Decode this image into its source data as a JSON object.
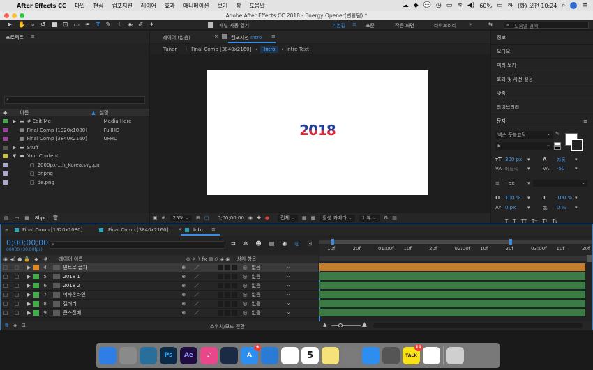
{
  "menubar": {
    "apple": "",
    "app_name": "After Effects CC",
    "items": [
      "파일",
      "편집",
      "컴포지션",
      "레이어",
      "효과",
      "애니메이션",
      "보기",
      "창",
      "도움말"
    ],
    "battery": "60%",
    "input_method": "한",
    "clock": "(화) 오전 10:24"
  },
  "window": {
    "title": "Adobe After Effects CC 2018 - Energy Opener(변환됨) *"
  },
  "toolbar": {
    "auto_open_label": "패널 자동 열기",
    "workspaces": [
      "기본값",
      "표준",
      "작은 화면",
      "라이브러리"
    ],
    "active_workspace": "기본값",
    "help_search_placeholder": "도움말 검색"
  },
  "project_panel": {
    "title": "프로젝트",
    "search_placeholder": "",
    "col_name": "이름",
    "col_desc": "설명",
    "items": [
      {
        "name": "# Edit Me",
        "desc": "Media Here",
        "color": "#3fae49",
        "type": "folder",
        "indent": 0
      },
      {
        "name": "Final Comp [1920x1080]",
        "desc": "FullHD",
        "color": "#a33ea4",
        "type": "comp",
        "indent": 0
      },
      {
        "name": "Final Comp [3840x2160]",
        "desc": "UFHD",
        "color": "#a33ea4",
        "type": "comp",
        "indent": 0
      },
      {
        "name": "Stuff",
        "desc": "",
        "color": "#555555",
        "type": "folder",
        "indent": 0
      },
      {
        "name": "Your Content",
        "desc": "",
        "color": "#c9c534",
        "type": "folder",
        "indent": 0
      },
      {
        "name": "2000px-...h_Korea.svg.png",
        "desc": "",
        "color": "#a7a7cf",
        "type": "file",
        "indent": 1
      },
      {
        "name": "br.png",
        "desc": "",
        "color": "#a7a7cf",
        "type": "file",
        "indent": 1
      },
      {
        "name": "de.png",
        "desc": "",
        "color": "#a7a7cf",
        "type": "file",
        "indent": 1
      }
    ],
    "bpc": "8bpc"
  },
  "viewer": {
    "layer_tab": "레이어 (없음)",
    "comp_tab_prefix": "컴포지션",
    "comp_tab_name": "Intro",
    "breadcrumb": [
      "Tuner",
      "Final Comp [3840x2160]",
      "Intro",
      "Intro Text"
    ],
    "canvas_text": "2018",
    "zoom": "25%",
    "timecode": "0;00;00;00",
    "resolution": "전체",
    "camera": "활성 카메라",
    "views": "1 뷰"
  },
  "right_panel": {
    "items": [
      "정보",
      "오디오",
      "미리 보기",
      "효과 및 사전 설정",
      "맞춤",
      "라이브러리"
    ],
    "character_title": "문자",
    "font_family": "넥슨 풋볼고딕",
    "font_style": "B",
    "font_size": "300 px",
    "leading": "자동",
    "kerning_label": "메트릭",
    "tracking": "-50",
    "stroke_width": "- px",
    "vscale": "100 %",
    "hscale": "100 %",
    "baseline": "0 px",
    "tsume": "0 %"
  },
  "timeline": {
    "tabs": [
      {
        "label": "Final Comp [1920x1080]",
        "color": "#2ba5b5"
      },
      {
        "label": "Final Comp [3840x2160]",
        "color": "#2ba5b5"
      },
      {
        "label": "Intro",
        "color": "#2ba5b5"
      }
    ],
    "timecode": "0;00;00;00",
    "fps": "00000 (30.00fps)",
    "search_placeholder": "",
    "col_num": "#",
    "col_layer": "레이어 이름",
    "col_parent": "상위 항목",
    "ruler_ticks": [
      "10f",
      "20f",
      "01:00f",
      "10f",
      "20f",
      "02:00f",
      "10f",
      "20f",
      "03:00f",
      "10f",
      "20f",
      "2"
    ],
    "layers": [
      {
        "num": "4",
        "name": "인트로 글자",
        "parent": "없음",
        "label_color": "#e08a26",
        "bar_color": "#c27d2f",
        "selected": true
      },
      {
        "num": "5",
        "name": "2018 1",
        "parent": "없음",
        "label_color": "#3fae49",
        "bar_color": "#3c7a46",
        "selected": false
      },
      {
        "num": "6",
        "name": "2018 2",
        "parent": "없음",
        "label_color": "#3fae49",
        "bar_color": "#3c7a46",
        "selected": false
      },
      {
        "num": "7",
        "name": "피파온라인",
        "parent": "없음",
        "label_color": "#3fae49",
        "bar_color": "#3c7a46",
        "selected": false
      },
      {
        "num": "8",
        "name": "갤러리",
        "parent": "없음",
        "label_color": "#3fae49",
        "bar_color": "#3c7a46",
        "selected": false
      },
      {
        "num": "9",
        "name": "큰스잡배",
        "parent": "없음",
        "label_color": "#3fae49",
        "bar_color": "#3c7a46",
        "selected": false
      }
    ],
    "footer_label": "스위치/모드 전환"
  },
  "dock": {
    "apps": [
      {
        "name": "finder",
        "label": "",
        "bg": "#2f7ee6"
      },
      {
        "name": "disk-utility",
        "label": "",
        "bg": "#8a8a8a"
      },
      {
        "name": "cyberduck",
        "label": "",
        "bg": "#2a6f9c"
      },
      {
        "name": "photoshop",
        "label": "Ps",
        "bg": "#0d2a47"
      },
      {
        "name": "after-effects",
        "label": "Ae",
        "bg": "#1f0d3f"
      },
      {
        "name": "itunes",
        "label": "♪",
        "bg": "#e9478a"
      },
      {
        "name": "steam",
        "label": "",
        "bg": "#1b2b45"
      },
      {
        "name": "app-store",
        "label": "A",
        "bg": "#2d8ef0"
      },
      {
        "name": "keynote",
        "label": "",
        "bg": "#2a7bd6"
      },
      {
        "name": "numbers",
        "label": "",
        "bg": "#ffffff"
      },
      {
        "name": "calendar",
        "label": "5",
        "bg": "#ffffff"
      },
      {
        "name": "notes",
        "label": "",
        "bg": "#f5e27a"
      },
      {
        "name": "system-preferences",
        "label": "",
        "bg": "#7b7b7b"
      },
      {
        "name": "safari",
        "label": "",
        "bg": "#2d8ef0"
      },
      {
        "name": "launchpad",
        "label": "",
        "bg": "#555555"
      },
      {
        "name": "kakaotalk",
        "label": "TALK",
        "bg": "#f7e21a"
      },
      {
        "name": "chrome",
        "label": "",
        "bg": "#ffffff"
      },
      {
        "name": "trash",
        "label": "",
        "bg": "#cfcfcf"
      }
    ],
    "app_store_badge": "9",
    "kakao_badge": "11"
  }
}
